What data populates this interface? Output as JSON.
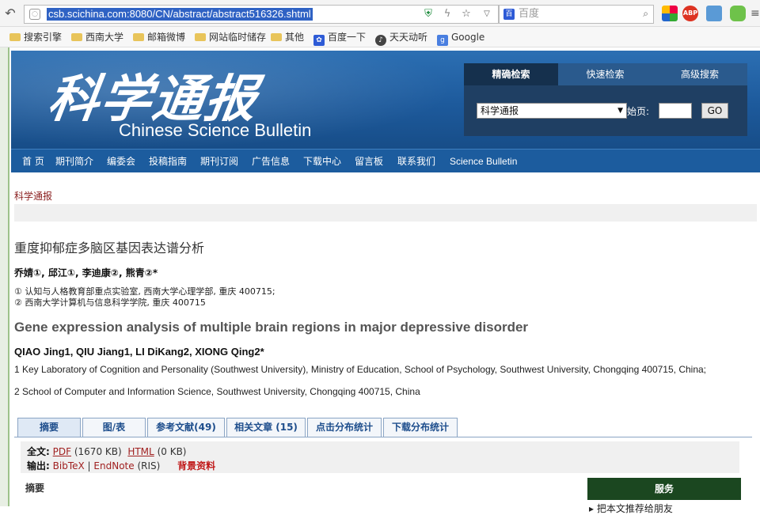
{
  "browser": {
    "url": "csb.scichina.com:8080/CN/abstract/abstract516326.shtml",
    "search_placeholder": "百度",
    "search_engine_badge": "百"
  },
  "bookmarks": [
    {
      "label": "搜索引擎",
      "icon": "folder-icon"
    },
    {
      "label": "西南大学",
      "icon": "folder-icon"
    },
    {
      "label": "邮箱微博",
      "icon": "folder-icon"
    },
    {
      "label": "网站临时储存",
      "icon": "folder-icon"
    },
    {
      "label": "其他",
      "icon": "folder-icon"
    },
    {
      "label": "百度一下",
      "icon": "baidu-paw-icon"
    },
    {
      "label": "天天动听",
      "icon": "music-icon"
    },
    {
      "label": "Google",
      "icon": "google-icon"
    }
  ],
  "banner": {
    "cn_title": "科学通报",
    "en_title": "Chinese Science Bulletin"
  },
  "search_panel": {
    "tabs": [
      "精确检索",
      "快速检索",
      "高级搜索"
    ],
    "journal_select": "科学通报",
    "start_page_label": "始页:",
    "go_label": "GO"
  },
  "nav": [
    "首 页",
    "期刊简介",
    "编委会",
    "投稿指南",
    "期刊订阅",
    "广告信息",
    "下载中心",
    "留言板",
    "联系我们",
    "Science Bulletin"
  ],
  "breadcrumb": "科学通报",
  "article": {
    "cn_title": "重度抑郁症多脑区基因表达谱分析",
    "cn_authors": "乔婧①, 邱江①, 李迪康②, 熊青②*",
    "cn_affiliations": [
      "① 认知与人格教育部重点实验室, 西南大学心理学部, 重庆 400715;",
      "② 西南大学计算机与信息科学学院, 重庆 400715"
    ],
    "en_title": "Gene expression analysis of multiple brain regions in major depressive disorder",
    "en_authors": "QIAO Jing1, QIU Jiang1, LI DiKang2, XIONG Qing2*",
    "en_affiliations": [
      "1 Key Laboratory of Cognition and Personality (Southwest University), Ministry of Education, School of Psychology, Southwest University, Chongqing 400715, China;",
      "2 School of Computer and Information Science, Southwest University, Chongqing 400715, China"
    ]
  },
  "tabs": [
    "摘要",
    "图/表",
    "参考文献(49)",
    "相关文章 (15)",
    "点击分布统计",
    "下载分布统计"
  ],
  "fulltext": {
    "label": "全文:",
    "pdf": "PDF",
    "pdf_size": "(1670 KB)",
    "html": "HTML",
    "html_size": "(0 KB)",
    "export_label": "输出:",
    "bibtex": "BibTeX",
    "sep": "|",
    "endnote": "EndNote",
    "endnote_fmt": "(RIS)",
    "background": "背景资料"
  },
  "abstract_heading": "摘要",
  "service": {
    "title": "服务",
    "first_item": "▸ 把本文推荐给朋友"
  }
}
